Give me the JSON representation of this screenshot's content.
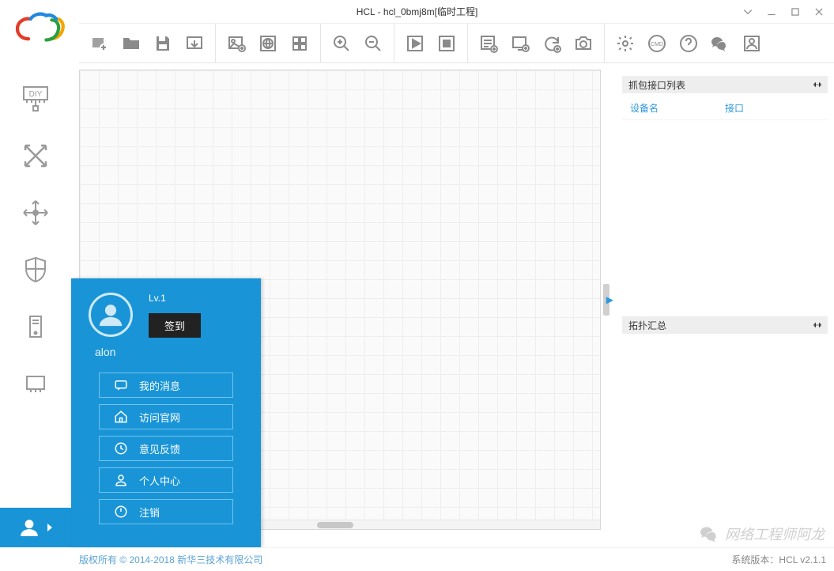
{
  "title": "HCL - hcl_0bmj8m[临时工程]",
  "right_panels": {
    "capture": {
      "title": "抓包接口列表",
      "col1": "设备名",
      "col2": "接口"
    },
    "topo": {
      "title": "拓扑汇总"
    }
  },
  "footer": {
    "copyright": "版权所有 © 2014-2018 新华三技术有限公司",
    "version": "系统版本：HCL v2.1.1"
  },
  "user_popup": {
    "level": "Lv.1",
    "signin": "签到",
    "username": "alon",
    "menu": {
      "msg": "我的消息",
      "site": "访问官网",
      "feedback": "意见反馈",
      "profile": "个人中心",
      "logout": "注销"
    }
  },
  "watermark": "网络工程师阿龙"
}
